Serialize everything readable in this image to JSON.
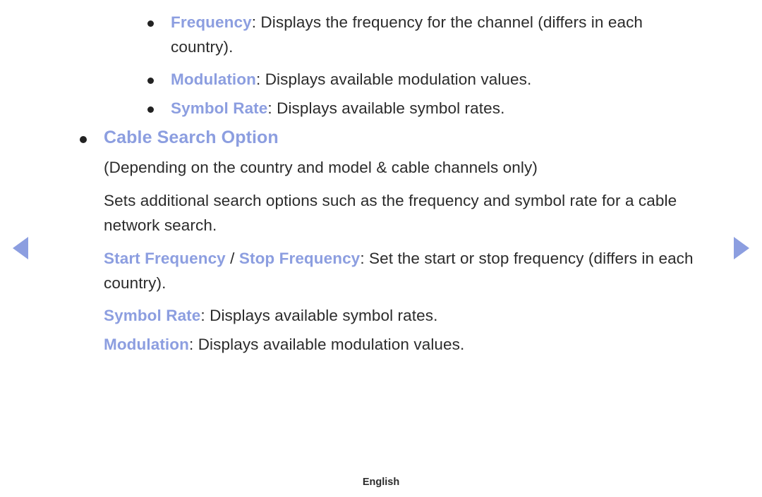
{
  "nav": {
    "prev_icon": "left-triangle-icon",
    "next_icon": "right-triangle-icon"
  },
  "accent_color": "#8c9ee0",
  "text_color": "#2b2b2b",
  "background_color": "#ffffff",
  "items": [
    {
      "keyword": "Frequency",
      "colon": ":",
      "body": " Displays the frequency for the channel (differs in each country)."
    },
    {
      "keyword": "Modulation",
      "colon": ":",
      "body": " Displays available modulation values."
    },
    {
      "keyword": "Symbol Rate",
      "colon": ":",
      "body": " Displays available symbol rates."
    }
  ],
  "section": {
    "heading": "Cable Search Option",
    "note": "(Depending on the country and model & cable channels only)",
    "description": "Sets additional search options such as the frequency and symbol rate for a cable network search.",
    "entries": [
      {
        "keyword": "Start Frequency",
        "separator": " / ",
        "keyword2": "Stop Frequency",
        "colon": ":",
        "body": " Set the start or stop frequency (differs in each country)."
      },
      {
        "keyword": "Symbol Rate",
        "colon": ":",
        "body": " Displays available symbol rates."
      },
      {
        "keyword": "Modulation",
        "colon": ":",
        "body": " Displays available modulation values."
      }
    ]
  },
  "footer": {
    "language": "English"
  }
}
